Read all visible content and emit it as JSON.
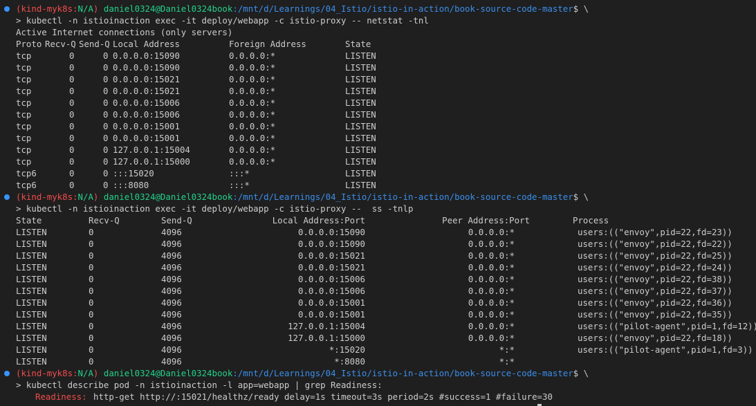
{
  "colors": {
    "background": "#1f1f1f",
    "text": "#cccccc",
    "prompt_dot": "#3794ff",
    "kube_label": "#f14c4c",
    "user_host": "#23d18b",
    "path": "#3b8eea",
    "readiness_label": "#f14c4c"
  },
  "prompt": {
    "kind_open": "(kind-myk8s:",
    "kind_ns": "N/A",
    "kind_close": ")",
    "user_host": "daniel0324@Daniel0324book",
    "path": ":/mnt/d/Learnings/04_Istio/istio-in-action/book-source-code-master",
    "suffix": "$ \\"
  },
  "block1": {
    "command": "> kubectl -n istioinaction exec -it deploy/webapp -c istio-proxy -- netstat -tnl",
    "title": "Active Internet connections (only servers)",
    "headers": {
      "proto": "Proto",
      "recvq": "Recv-Q",
      "sendq": "Send-Q",
      "local": "Local Address",
      "foreign": "Foreign Address",
      "state": "State"
    },
    "rows": [
      {
        "proto": "tcp",
        "recvq": "0",
        "sendq": "0",
        "local": "0.0.0.0:15090",
        "foreign": "0.0.0.0:*",
        "state": "LISTEN"
      },
      {
        "proto": "tcp",
        "recvq": "0",
        "sendq": "0",
        "local": "0.0.0.0:15090",
        "foreign": "0.0.0.0:*",
        "state": "LISTEN"
      },
      {
        "proto": "tcp",
        "recvq": "0",
        "sendq": "0",
        "local": "0.0.0.0:15021",
        "foreign": "0.0.0.0:*",
        "state": "LISTEN"
      },
      {
        "proto": "tcp",
        "recvq": "0",
        "sendq": "0",
        "local": "0.0.0.0:15021",
        "foreign": "0.0.0.0:*",
        "state": "LISTEN"
      },
      {
        "proto": "tcp",
        "recvq": "0",
        "sendq": "0",
        "local": "0.0.0.0:15006",
        "foreign": "0.0.0.0:*",
        "state": "LISTEN"
      },
      {
        "proto": "tcp",
        "recvq": "0",
        "sendq": "0",
        "local": "0.0.0.0:15006",
        "foreign": "0.0.0.0:*",
        "state": "LISTEN"
      },
      {
        "proto": "tcp",
        "recvq": "0",
        "sendq": "0",
        "local": "0.0.0.0:15001",
        "foreign": "0.0.0.0:*",
        "state": "LISTEN"
      },
      {
        "proto": "tcp",
        "recvq": "0",
        "sendq": "0",
        "local": "0.0.0.0:15001",
        "foreign": "0.0.0.0:*",
        "state": "LISTEN"
      },
      {
        "proto": "tcp",
        "recvq": "0",
        "sendq": "0",
        "local": "127.0.0.1:15004",
        "foreign": "0.0.0.0:*",
        "state": "LISTEN"
      },
      {
        "proto": "tcp",
        "recvq": "0",
        "sendq": "0",
        "local": "127.0.0.1:15000",
        "foreign": "0.0.0.0:*",
        "state": "LISTEN"
      },
      {
        "proto": "tcp6",
        "recvq": "0",
        "sendq": "0",
        "local": ":::15020",
        "foreign": ":::*",
        "state": "LISTEN"
      },
      {
        "proto": "tcp6",
        "recvq": "0",
        "sendq": "0",
        "local": ":::8080",
        "foreign": ":::*",
        "state": "LISTEN"
      }
    ]
  },
  "block2": {
    "command": "> kubectl -n istioinaction exec -it deploy/webapp -c istio-proxy --  ss -tnlp",
    "headers": {
      "state": "State",
      "recvq": "Recv-Q",
      "sendq": "Send-Q",
      "local": "Local Address:Port",
      "peer": "Peer Address:Port",
      "process": "Process"
    },
    "rows": [
      {
        "state": "LISTEN",
        "recvq": "0",
        "sendq": "4096",
        "local": "0.0.0.0:15090",
        "peer": "0.0.0.0:*",
        "process": "users:((\"envoy\",pid=22,fd=23))"
      },
      {
        "state": "LISTEN",
        "recvq": "0",
        "sendq": "4096",
        "local": "0.0.0.0:15090",
        "peer": "0.0.0.0:*",
        "process": "users:((\"envoy\",pid=22,fd=22))"
      },
      {
        "state": "LISTEN",
        "recvq": "0",
        "sendq": "4096",
        "local": "0.0.0.0:15021",
        "peer": "0.0.0.0:*",
        "process": "users:((\"envoy\",pid=22,fd=25))"
      },
      {
        "state": "LISTEN",
        "recvq": "0",
        "sendq": "4096",
        "local": "0.0.0.0:15021",
        "peer": "0.0.0.0:*",
        "process": "users:((\"envoy\",pid=22,fd=24))"
      },
      {
        "state": "LISTEN",
        "recvq": "0",
        "sendq": "4096",
        "local": "0.0.0.0:15006",
        "peer": "0.0.0.0:*",
        "process": "users:((\"envoy\",pid=22,fd=38))"
      },
      {
        "state": "LISTEN",
        "recvq": "0",
        "sendq": "4096",
        "local": "0.0.0.0:15006",
        "peer": "0.0.0.0:*",
        "process": "users:((\"envoy\",pid=22,fd=37))"
      },
      {
        "state": "LISTEN",
        "recvq": "0",
        "sendq": "4096",
        "local": "0.0.0.0:15001",
        "peer": "0.0.0.0:*",
        "process": "users:((\"envoy\",pid=22,fd=36))"
      },
      {
        "state": "LISTEN",
        "recvq": "0",
        "sendq": "4096",
        "local": "0.0.0.0:15001",
        "peer": "0.0.0.0:*",
        "process": "users:((\"envoy\",pid=22,fd=35))"
      },
      {
        "state": "LISTEN",
        "recvq": "0",
        "sendq": "4096",
        "local": "127.0.0.1:15004",
        "peer": "0.0.0.0:*",
        "process": "users:((\"pilot-agent\",pid=1,fd=12))"
      },
      {
        "state": "LISTEN",
        "recvq": "0",
        "sendq": "4096",
        "local": "127.0.0.1:15000",
        "peer": "0.0.0.0:*",
        "process": "users:((\"envoy\",pid=22,fd=18))"
      },
      {
        "state": "LISTEN",
        "recvq": "0",
        "sendq": "4096",
        "local": "*:15020",
        "peer": "*:*",
        "process": "users:((\"pilot-agent\",pid=1,fd=3))"
      },
      {
        "state": "LISTEN",
        "recvq": "0",
        "sendq": "4096",
        "local": "*:8080",
        "peer": "*:*",
        "process": ""
      }
    ]
  },
  "block3": {
    "command": "> kubectl describe pod -n istioinaction -l app=webapp | grep Readiness:",
    "label": "Readiness:",
    "value": "http-get http://:15021/healthz/ready delay=1s timeout=3s period=2s #success=1 #failure=30"
  }
}
